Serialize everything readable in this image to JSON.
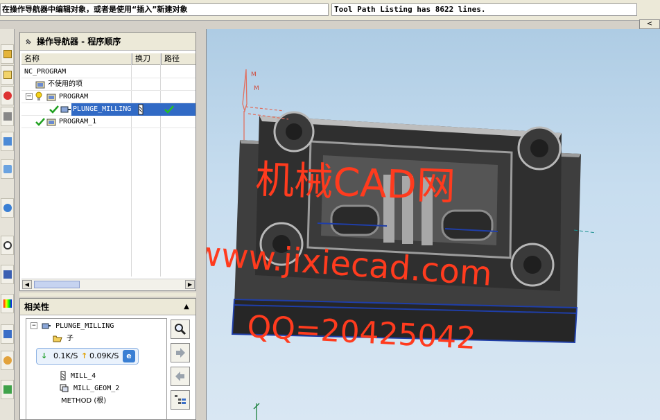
{
  "status": {
    "message": "在操作导航器中编辑对象，或者是使用“插入”新建对象",
    "info": "Tool Path Listing has 8622 lines.",
    "button_label": "<"
  },
  "navigator": {
    "title": "操作导航器 - 程序顺序",
    "columns": [
      "名称",
      "换刀",
      "路径"
    ],
    "rows": [
      {
        "name": "NC_PROGRAM"
      },
      {
        "name": "不使用的项"
      },
      {
        "name": "PROGRAM"
      },
      {
        "name": "PLUNGE_MILLING"
      },
      {
        "name": "PROGRAM_1"
      }
    ]
  },
  "dependencies": {
    "title": "相关性",
    "collapse": "▲",
    "tree": [
      {
        "name": "PLUNGE_MILLING"
      },
      {
        "name": "子"
      },
      {
        "name": "MILL_4"
      },
      {
        "name": "MILL_GEOM_2"
      },
      {
        "name": "METHOD (根)"
      }
    ]
  },
  "speed": {
    "down": "0.1K/S",
    "up": "0.09K/S"
  },
  "watermark": {
    "line1": "机械CAD网",
    "line2": "www.jixiecad.com",
    "line3": "QQ=20425042"
  },
  "triad_labels": {
    "m1": "M",
    "m2": "M"
  },
  "colors": {
    "selection": "#316ac5",
    "check": "#1fa01f",
    "watermark": "#ff3b1e"
  }
}
